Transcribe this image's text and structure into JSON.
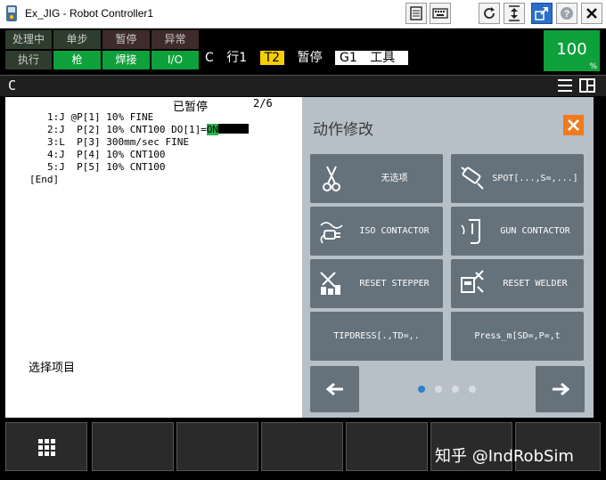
{
  "window": {
    "title": "Ex_JIG - Robot Controller1"
  },
  "titlebar_icons": [
    "pendant-icon",
    "keyboard-icon",
    "refresh-icon",
    "fit-icon",
    "maximize-out-icon",
    "help-icon",
    "close-icon"
  ],
  "status": {
    "processing": "处理中",
    "single_step": "单步",
    "hold": "暂停",
    "fault": "异常",
    "run": "执行",
    "gun": "枪",
    "weld": "焊接",
    "io": "I/O",
    "program": "C",
    "line": "行1",
    "mode": "T2",
    "state": "暂停",
    "group": "G1",
    "frame": "工具",
    "override_value": "100",
    "override_unit": "%"
  },
  "colors": {
    "active_green": "#0ea13b",
    "mode_yellow": "#f5d000",
    "close_orange": "#f07b1f",
    "panel_bg": "#b7bfc7",
    "button_bg": "#65717b"
  },
  "editor": {
    "window_title": "C",
    "paused_label": "已暂停",
    "page_indicator": "2/6",
    "lines": [
      "1:J @P[1] 10% FINE",
      "2:J  P[2] 10% CNT100 DO[1]=",
      "3:L  P[3] 300mm/sec FINE",
      "4:J  P[4] 10% CNT100",
      "5:J  P[5] 10% CNT100",
      "[End]"
    ],
    "highlight": "ON",
    "prompt": "选择项目"
  },
  "panel": {
    "title": "动作修改",
    "options": [
      {
        "label": "无选项",
        "icon": "scissors-icon"
      },
      {
        "label": "SPOT[...,S=,...]",
        "icon": "spot-gun-icon"
      },
      {
        "label": "ISO CONTACTOR",
        "icon": "plug-icon"
      },
      {
        "label": "GUN CONTACTOR",
        "icon": "gun-contactor-icon"
      },
      {
        "label": "RESET STEPPER",
        "icon": "reset-stepper-icon"
      },
      {
        "label": "RESET WELDER",
        "icon": "reset-welder-icon"
      },
      {
        "label": "TIPDRESS[.,TD=,.",
        "icon": ""
      },
      {
        "label": "Press_m[SD=,P=,t",
        "icon": ""
      }
    ],
    "page_dots": 4,
    "current_page": 1
  },
  "footer": {
    "menu_icon": "grid-icon",
    "watermark": "知乎 @IndRobSim"
  }
}
